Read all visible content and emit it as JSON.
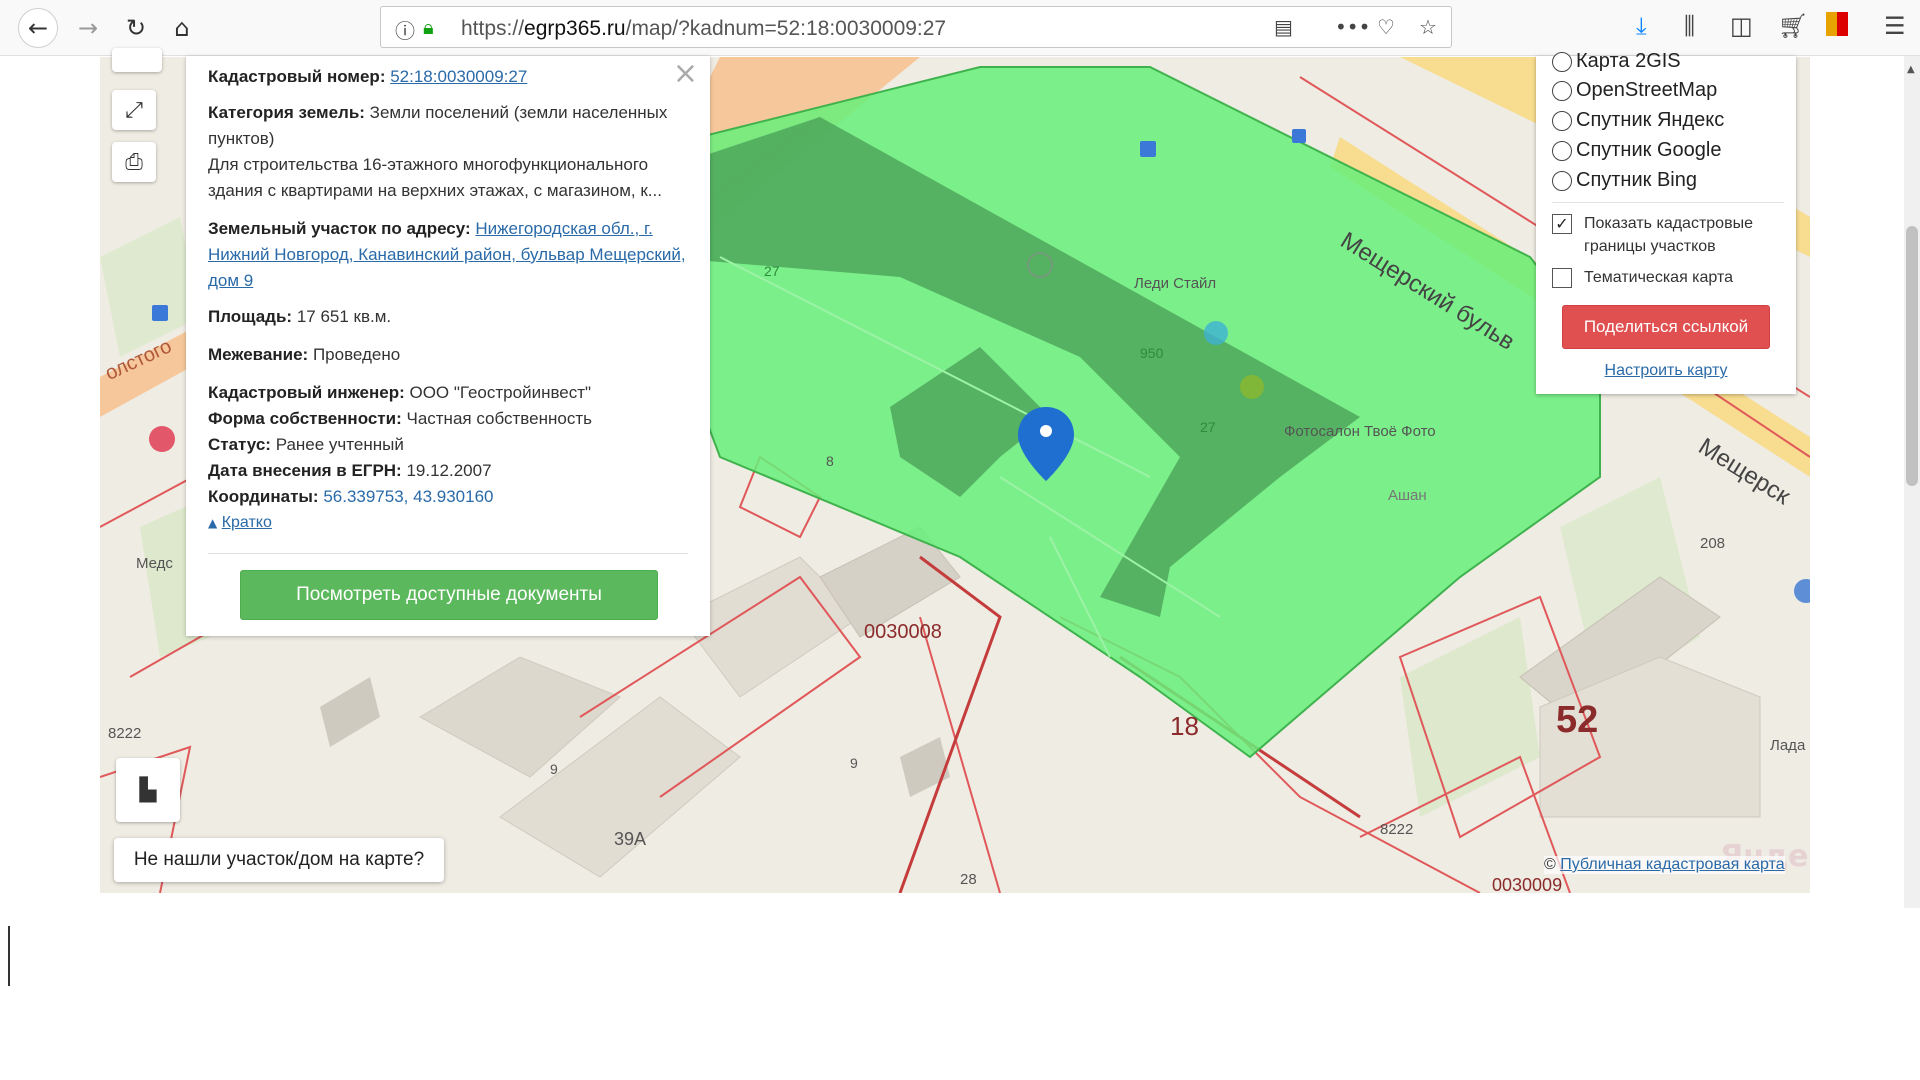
{
  "browser": {
    "url_base": "https://",
    "url_domain": "egrp365.ru",
    "url_path": "/map/?kadnum=52:18:0030009:27"
  },
  "info_panel": {
    "cadastral_label": "Кадастровый номер:",
    "cadastral_value": "52:18:0030009:27",
    "category_label": "Категория земель:",
    "category_value": "Земли поселений (земли населенных пунктов)",
    "purpose_text": "Для строительства 16-этажного многофункционального здания с квартирами на верхних этажах, с магазином, к...",
    "address_label": "Земельный участок по адресу:",
    "address_value": "Нижегородская обл., г. Нижний Новгород, Канавинский район, бульвар Мещерский, дом 9",
    "area_label": "Площадь:",
    "area_value": "17 651 кв.м.",
    "survey_label": "Межевание:",
    "survey_value": "Проведено",
    "engineer_label": "Кадастровый инженер:",
    "engineer_value": "ООО \"Геостройинвест\"",
    "ownership_label": "Форма собственности:",
    "ownership_value": "Частная собственность",
    "status_label": "Статус:",
    "status_value": "Ранее учтенный",
    "date_label": "Дата внесения в ЕГРН:",
    "date_value": "19.12.2007",
    "coords_label": "Координаты:",
    "coords_value": "56.339753, 43.930160",
    "brief_link": "Кратко",
    "docs_button": "Посмотреть доступные документы"
  },
  "layers_panel": {
    "layers": [
      "Карта 2GIS",
      "OpenStreetMap",
      "Спутник Яндекс",
      "Спутник Google",
      "Спутник Bing"
    ],
    "show_borders_label": "Показать кадастровые границы участков",
    "show_borders_checked": true,
    "thematic_label": "Тематическая карта",
    "thematic_checked": false,
    "share_button": "Поделиться ссылкой",
    "setup_link": "Настроить карту"
  },
  "map": {
    "not_found_button": "Не нашли участок/дом на карте?",
    "attribution_prefix": "©",
    "attribution_link": "Публичная кадастровая карта",
    "yandex_mark": "Яндекс",
    "labels": {
      "street1": "Мещерский бульв",
      "street2": "Мещерск",
      "street3": "олстого",
      "poi1": "Леди Стайл",
      "poi2": "Фотосалон Твоё Фото",
      "poi3": "Ашан",
      "poi4": "Медс",
      "poi5": "Лада",
      "quarter1": "0030008",
      "quarter2": "0030009",
      "district": "18",
      "region": "52",
      "n8222a": "8222",
      "n8222b": "8222",
      "n208": "208",
      "n950": "950",
      "n27a": "27",
      "n27b": "27",
      "n8": "8",
      "n9a": "9",
      "n9b": "9",
      "n39a": "39А",
      "n28": "28"
    }
  }
}
